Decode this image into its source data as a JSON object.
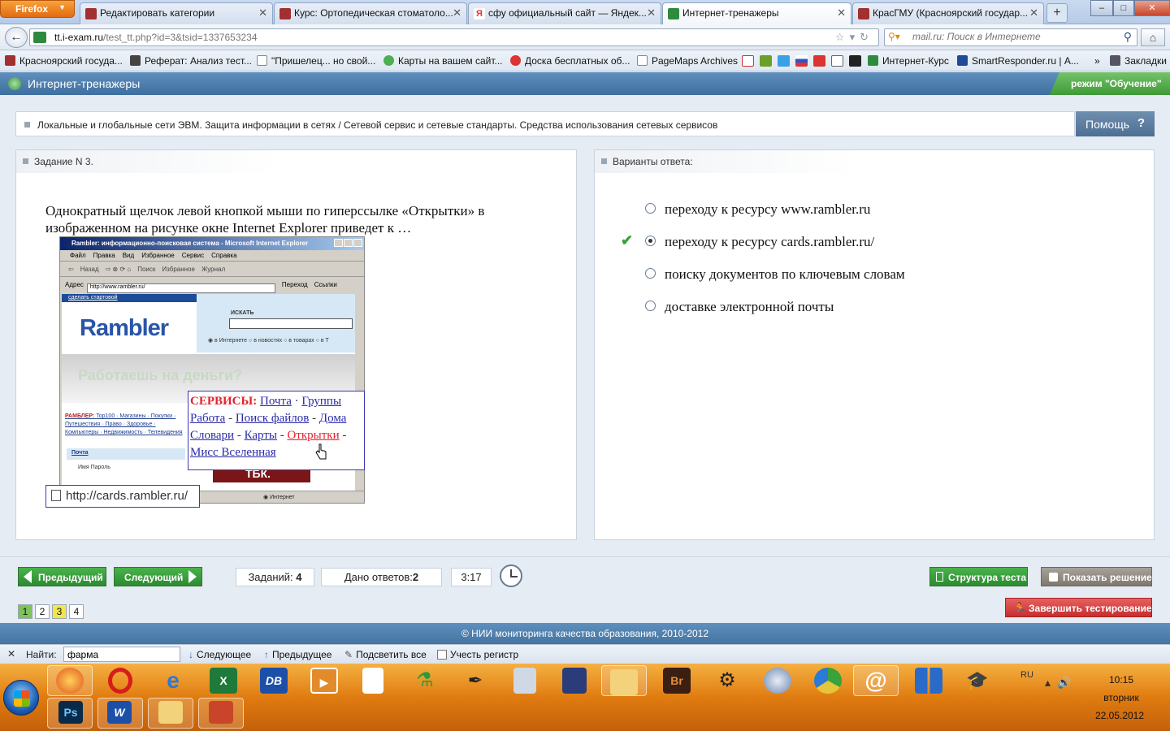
{
  "browser": {
    "menu_button": "Firefox",
    "tabs": [
      {
        "title": "Редактировать категории",
        "favicon_color": "#a33030"
      },
      {
        "title": "Курс: Ортопедическая стоматоло...",
        "favicon_color": "#a33030"
      },
      {
        "title": "сфу официальный сайт — Яндек...",
        "favicon_color": "#e33"
      },
      {
        "title": "Интернет-тренажеры",
        "favicon_color": "#2e8b3e",
        "active": true
      },
      {
        "title": "КрасГМУ (Красноярский государ...",
        "favicon_color": "#a33030"
      }
    ],
    "new_tab": "+",
    "window_buttons": {
      "minimize": "–",
      "maximize": "□",
      "close": "✕"
    },
    "url": {
      "domain": "tt.i-exam.ru",
      "path": "/test_tt.php?id=3&tsid=1337653234"
    },
    "search_placeholder": "mail.ru: Поиск в Интернете",
    "bookmarks": [
      {
        "label": "Красноярский госуда...",
        "color": "#a33030"
      },
      {
        "label": "Реферат: Анализ тест...",
        "color": "#444"
      },
      {
        "label": "\"Пришелец... но свой...",
        "color": "#ddd"
      },
      {
        "label": "Карты на вашем сайт...",
        "color": "#4caf50"
      },
      {
        "label": "Доска бесплатных об...",
        "color": "#d33"
      },
      {
        "label": "PageMaps Archives",
        "color": "#ddd"
      },
      {
        "label": "Интернет-Курс",
        "color": "#2e8b3e"
      },
      {
        "label": "SmartResponder.ru | А...",
        "color": "#1c4b9a"
      }
    ],
    "bookmarks_more": "»",
    "bookmarks_folder": "Закладки"
  },
  "app": {
    "title": "Интернет-тренажеры",
    "mode": "режим \"Обучение\"",
    "topic": "Локальные и глобальные сети ЭВМ. Защита информации в сетях / Сетевой сервис и сетевые стандарты. Средства использования сетевых сервисов",
    "help_label": "Помощь",
    "help_icon": "?"
  },
  "task": {
    "header": "Задание N 3.",
    "question": "Однократный щелчок левой кнопкой мыши по гиперссылке «Открытки» в изображенном на рисунке окне Internet Explorer приведет к …",
    "figure": {
      "window_title": "Rambler: информационно-поисковая система - Microsoft Internet Explorer",
      "menu": [
        "Файл",
        "Правка",
        "Вид",
        "Избранное",
        "Сервис",
        "Справка"
      ],
      "toolbar": [
        "Назад",
        "Поиск",
        "Избранное",
        "Журнал"
      ],
      "address_label": "Адрес",
      "address_value": "http://www.rambler.ru/",
      "go_label": "Переход",
      "links_label": "Ссылки",
      "make_start": "сделать стартовой",
      "logo": "Rambler",
      "search_label": "ИСКАТЬ",
      "radios": "◉ в Интернете ○ в новостях ○ в товарах ○ в Т",
      "banner": "Работаешь на деньги?",
      "left_col_brand": "РАМБЛЕР:",
      "left_col_links": "Top100 · Магазины · Покупки · Путешествия · Право · Здоровье · Компьютеры · Недвижимость · Телевидения",
      "mail": "Почта",
      "login": "Имя        Пароль",
      "tbk": "ТБК.",
      "status_zone": "Интернет",
      "services_title": "СЕРВИСЫ:",
      "services": [
        "Почта",
        "Группы",
        "Работа",
        "Поиск файлов",
        "Дома",
        "Словари",
        "Карты",
        "Открытки",
        "Мисс Вселенная"
      ],
      "status_url": "http://cards.rambler.ru/"
    }
  },
  "answers": {
    "header": "Варианты ответа:",
    "options": [
      {
        "text": "переходу к ресурсу www.rambler.ru",
        "selected": false,
        "correct": false
      },
      {
        "text": "переходу к ресурсу cards.rambler.ru/",
        "selected": true,
        "correct": true
      },
      {
        "text": "поиску документов по ключевым словам",
        "selected": false,
        "correct": false
      },
      {
        "text": "доставке электронной почты",
        "selected": false,
        "correct": false
      }
    ],
    "correct_mark": "✔"
  },
  "controls": {
    "prev": "Предыдущий",
    "next": "Следующий",
    "tasks_label": "Заданий:",
    "tasks_value": "4",
    "answered_label": "Дано ответов:",
    "answered_value": "2",
    "timer": "3:17",
    "structure": "Структура теста",
    "show_solution": "Показать решение",
    "finish": "Завершить тестирование",
    "pages": [
      "1",
      "2",
      "3",
      "4"
    ],
    "page_colors": {
      "current": "#7fc25c",
      "answered": "#f2e64a",
      "none": "#ffffff"
    }
  },
  "footer": "© НИИ мониторинга качества образования, 2010-2012",
  "findbar": {
    "close": "✕",
    "label": "Найти:",
    "value": "фарма",
    "next": "Следующее",
    "prev": "Предыдущее",
    "highlight": "Подсветить все",
    "match_case": "Учесть регистр"
  },
  "taskbar": {
    "lang": "RU",
    "time": "10:15",
    "day": "вторник",
    "date": "22.05.2012",
    "pinned_row1": [
      "firefox",
      "opera",
      "internet-explorer",
      "excel",
      "db",
      "media",
      "notepad",
      "paint",
      "pen",
      "calculator",
      "floppy",
      "folder",
      "bridge",
      "network",
      "shield",
      "chrome",
      "mail"
    ],
    "pinned_row2": [
      "photoshop",
      "word",
      "explorer",
      "powerpoint"
    ]
  }
}
